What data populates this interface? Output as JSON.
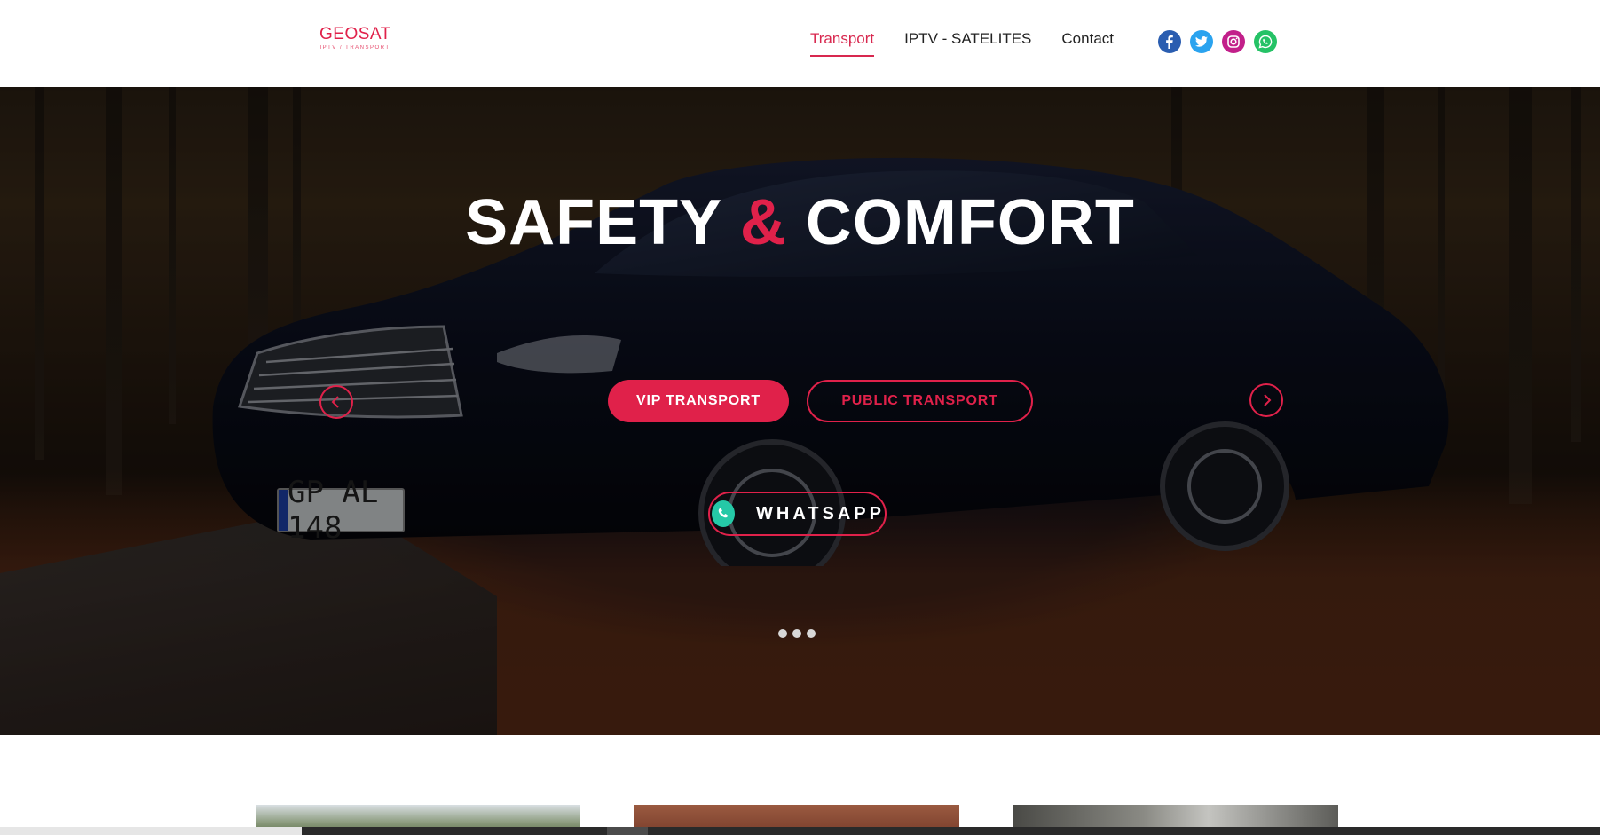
{
  "brand": {
    "title": "GEOSAT",
    "subtitle": "IPTV / TRANSPORT",
    "accent_color": "#e0214a"
  },
  "nav": {
    "items": [
      {
        "label": "Transport",
        "active": true
      },
      {
        "label": "IPTV - SATELITES",
        "active": false
      },
      {
        "label": "Contact",
        "active": false
      }
    ]
  },
  "socials": [
    {
      "icon": "facebook-icon",
      "color": "#2a5db0"
    },
    {
      "icon": "twitter-icon",
      "color": "#2aa3ef"
    },
    {
      "icon": "instagram-icon",
      "color": "#c21f8a"
    },
    {
      "icon": "whatsapp-icon",
      "color": "#25c266"
    }
  ],
  "hero": {
    "title_part1": "SAFETY",
    "title_amp": "&",
    "title_part2": "COMFORT",
    "plate": "GP AL 148",
    "buttons": {
      "vip": "VIP TRANSPORT",
      "public": "PUBLIC TRANSPORT"
    },
    "whatsapp_label": "WHATSAPP",
    "slides_count": 3,
    "active_slide": 1
  }
}
